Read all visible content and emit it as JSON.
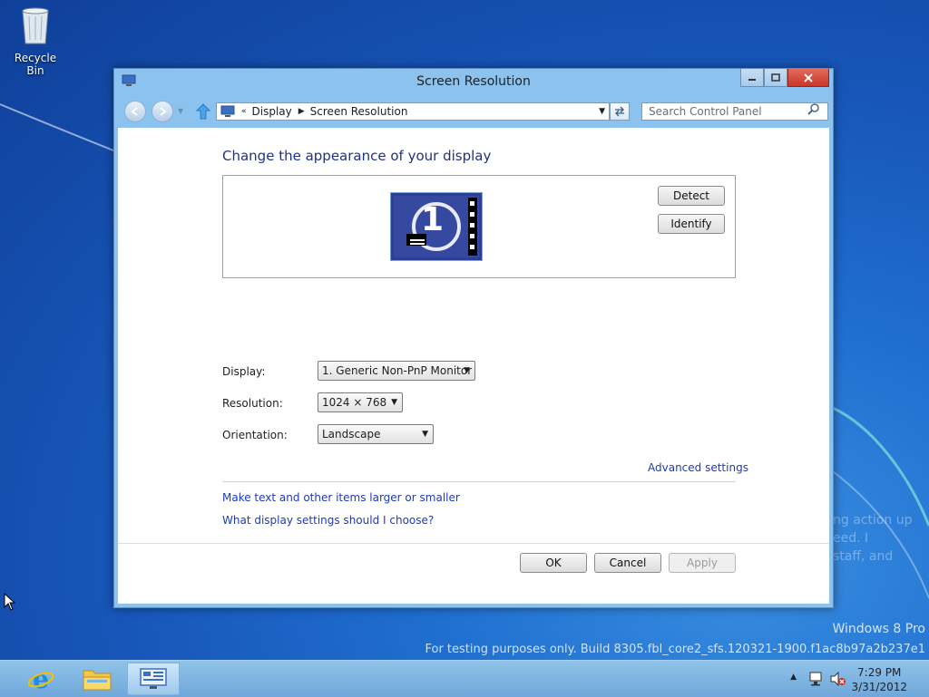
{
  "desktop": {
    "recycle_bin_label": "Recycle Bin",
    "watermark_build": "For testing purposes only. Build 8305.fbl_core2_sfs.120321-1900.f1ac8b97a2b237e1",
    "watermark_edition": "Windows 8 Pro"
  },
  "window": {
    "title": "Screen Resolution",
    "breadcrumb": [
      "Display",
      "Screen Resolution"
    ],
    "search_placeholder": "Search Control Panel"
  },
  "main": {
    "heading": "Change the appearance of your display",
    "monitor_number": "1",
    "detect_label": "Detect",
    "identify_label": "Identify",
    "display_label": "Display:",
    "display_value": "1. Generic Non-PnP Monitor",
    "resolution_label": "Resolution:",
    "resolution_value": "1024 × 768",
    "orientation_label": "Orientation:",
    "orientation_value": "Landscape",
    "advanced_link": "Advanced settings",
    "text_size_link": "Make text and other items larger or smaller",
    "help_link": "What display settings should I choose?"
  },
  "footer": {
    "ok_label": "OK",
    "cancel_label": "Cancel",
    "apply_label": "Apply"
  },
  "taskbar": {
    "time": "7:29 PM",
    "date": "3/31/2012"
  },
  "colors": {
    "link": "#1e3ab8",
    "heading": "#1e3287",
    "accent": "#8bc2ee"
  }
}
